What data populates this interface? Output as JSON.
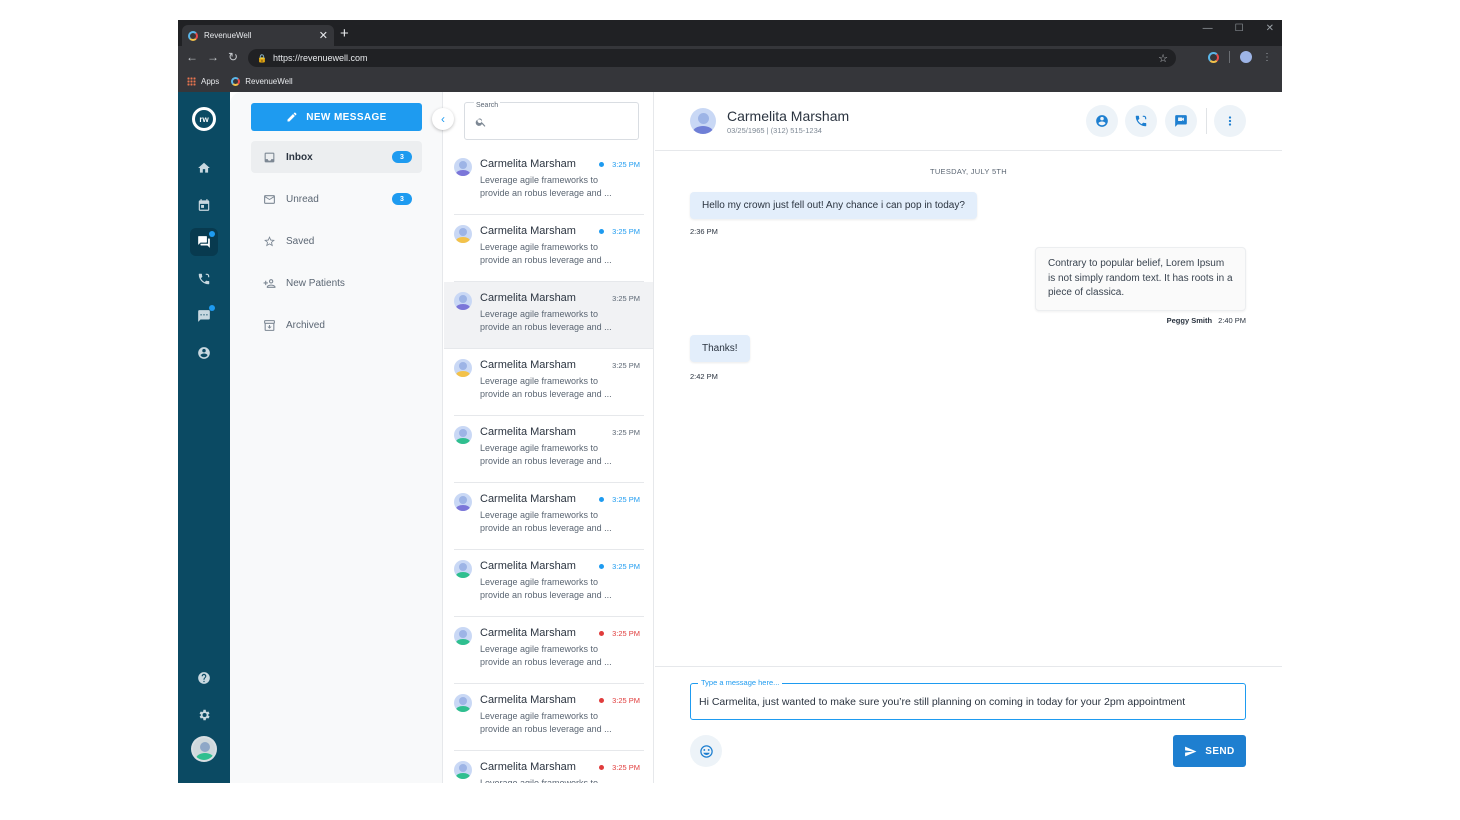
{
  "browser": {
    "tab_title": "RevenueWell",
    "url": "https://revenuewell.com",
    "bookmarks": [
      {
        "label": "Apps"
      },
      {
        "label": "RevenueWell"
      }
    ]
  },
  "rail": {
    "logo_text": "rw",
    "items": [
      {
        "name": "home-icon",
        "active": false,
        "dot": false
      },
      {
        "name": "calendar-icon",
        "active": false,
        "dot": false
      },
      {
        "name": "chat-icon",
        "active": true,
        "dot": true
      },
      {
        "name": "phone-icon",
        "active": false,
        "dot": false
      },
      {
        "name": "message-square-icon",
        "active": false,
        "dot": true
      },
      {
        "name": "account-icon",
        "active": false,
        "dot": false
      }
    ],
    "bottom": [
      "help-icon",
      "settings-icon"
    ]
  },
  "folders": {
    "new_message_label": "NEW MESSAGE",
    "items": [
      {
        "label": "Inbox",
        "count": "3",
        "icon": "inbox-icon",
        "active": true
      },
      {
        "label": "Unread",
        "count": "3",
        "icon": "mail-icon",
        "active": false
      },
      {
        "label": "Saved",
        "count": "",
        "icon": "star-icon",
        "active": false
      },
      {
        "label": "New Patients",
        "count": "",
        "icon": "add-person-icon",
        "active": false
      },
      {
        "label": "Archived",
        "count": "",
        "icon": "archive-icon",
        "active": false
      }
    ]
  },
  "search": {
    "label": "Search"
  },
  "conversations": [
    {
      "name": "Carmelita Marsham",
      "time": "3:25 PM",
      "status": "blue",
      "preview": "Leverage agile frameworks to provide an robus leverage and ...",
      "avatar_color": "#7b76d9",
      "selected": false
    },
    {
      "name": "Carmelita Marsham",
      "time": "3:25 PM",
      "status": "blue",
      "preview": "Leverage agile frameworks to provide an robus leverage and ...",
      "avatar_color": "#f3c24a",
      "selected": false
    },
    {
      "name": "Carmelita Marsham",
      "time": "3:25 PM",
      "status": "none",
      "preview": "Leverage agile frameworks to provide an robus leverage and ...",
      "avatar_color": "#7b76d9",
      "selected": true
    },
    {
      "name": "Carmelita Marsham",
      "time": "3:25 PM",
      "status": "none",
      "preview": "Leverage agile frameworks to provide an robus leverage and ...",
      "avatar_color": "#f3c24a",
      "selected": false
    },
    {
      "name": "Carmelita Marsham",
      "time": "3:25 PM",
      "status": "none",
      "preview": "Leverage agile frameworks to provide an robus leverage and ...",
      "avatar_color": "#2fbf8f",
      "selected": false
    },
    {
      "name": "Carmelita Marsham",
      "time": "3:25 PM",
      "status": "blue",
      "preview": "Leverage agile frameworks to provide an robus leverage and ...",
      "avatar_color": "#7b76d9",
      "selected": false
    },
    {
      "name": "Carmelita Marsham",
      "time": "3:25 PM",
      "status": "blue",
      "preview": "Leverage agile frameworks to provide an robus leverage and ...",
      "avatar_color": "#2fbf8f",
      "selected": false
    },
    {
      "name": "Carmelita Marsham",
      "time": "3:25 PM",
      "status": "red",
      "preview": "Leverage agile frameworks to provide an robus leverage and ...",
      "avatar_color": "#2fbf8f",
      "selected": false
    },
    {
      "name": "Carmelita Marsham",
      "time": "3:25 PM",
      "status": "red",
      "preview": "Leverage agile frameworks to provide an robus leverage and ...",
      "avatar_color": "#2fbf8f",
      "selected": false
    },
    {
      "name": "Carmelita Marsham",
      "time": "3:25 PM",
      "status": "red",
      "preview": "Leverage agile frameworks to provide an robus leverage and ...",
      "avatar_color": "#2fbf8f",
      "selected": false
    }
  ],
  "chat": {
    "contact_name": "Carmelita Marsham",
    "contact_sub": "03/25/1965   |   (312) 515-1234",
    "date_separator": "TUESDAY, JULY 5TH",
    "messages": [
      {
        "dir": "in",
        "text": "Hello my crown just fell out! Any chance i can pop in today?",
        "time": "2:36 PM"
      },
      {
        "dir": "out",
        "text": "Contrary to popular belief, Lorem Ipsum is not simply random text. It has roots in a piece of classica.",
        "sender": "Peggy Smith",
        "time": "2:40 PM"
      },
      {
        "dir": "in",
        "text": "Thanks!",
        "time": "2:42 PM"
      }
    ],
    "composer": {
      "label": "Type a message here...",
      "value": "Hi Carmelita, just wanted to make sure you’re still planning on coming in today for your 2pm appointment",
      "send_label": "SEND"
    }
  },
  "colors": {
    "accent": "#1e9bf0",
    "rail": "#0b4a63",
    "unread_red": "#e03c3c"
  }
}
